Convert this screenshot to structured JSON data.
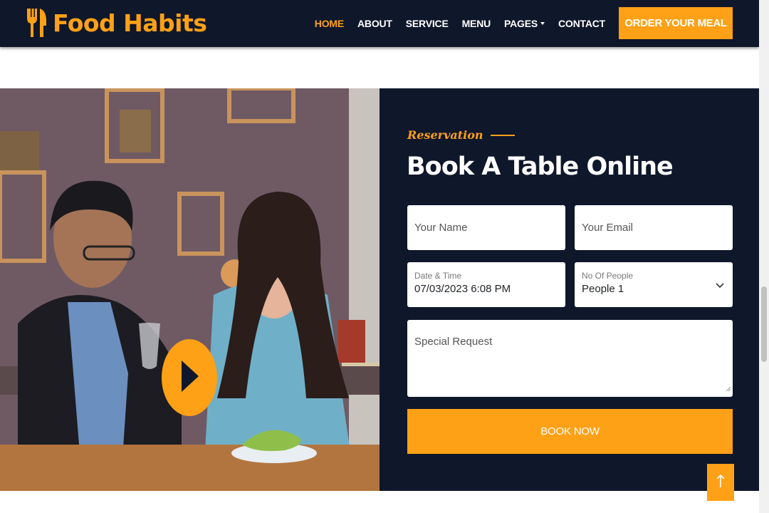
{
  "brand": {
    "name": "Food Habits",
    "icon": "utensils-icon",
    "color": "#fea116"
  },
  "nav": {
    "items": [
      {
        "label": "Home",
        "active": true
      },
      {
        "label": "About"
      },
      {
        "label": "Service"
      },
      {
        "label": "Menu"
      },
      {
        "label": "Pages",
        "dropdown": true
      },
      {
        "label": "Contact"
      }
    ],
    "cta": "Order Your Meal"
  },
  "hero_image": {
    "alt": "Couple dining at a restaurant",
    "play_icon": "play-icon"
  },
  "reservation": {
    "kicker": "Reservation",
    "title": "Book A Table Online",
    "name_placeholder": "Your Name",
    "email_placeholder": "Your Email",
    "datetime_label": "Date & Time",
    "datetime_value": "07/03/2023 6:08 PM",
    "people_label": "No Of People",
    "people_value": "People 1",
    "request_placeholder": "Special Request",
    "submit": "Book Now"
  },
  "back_to_top": {
    "icon": "arrow-up-icon"
  },
  "colors": {
    "primary": "#fea116",
    "dark": "#0f172b",
    "white": "#ffffff"
  }
}
